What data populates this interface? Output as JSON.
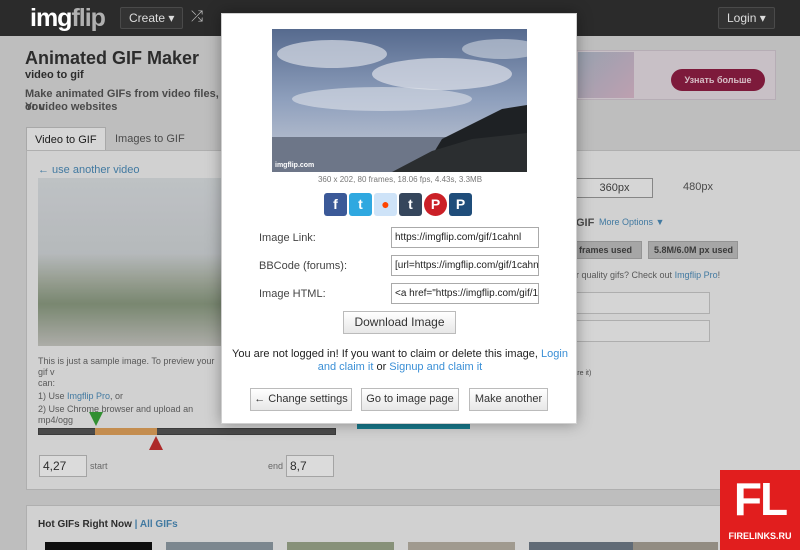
{
  "nav": {
    "logo_img": "img",
    "logo_flip": "flip",
    "create_label": "Create ▾",
    "shuffle_icon": "⤮",
    "login_label": "Login ▾"
  },
  "page": {
    "title": "Animated GIF Maker",
    "subtitle": "video to gif",
    "description_line1": "Make animated GIFs from video files, You",
    "description_line2": "or video websites",
    "tabs": [
      {
        "label": "Video to GIF"
      },
      {
        "label": "Images to GIF"
      }
    ],
    "use_another": "← use another video",
    "sample_note_intro": "This is just a sample image. To preview your gif v",
    "sample_note_can": "can:",
    "sample_note_opt1_prefix": "1) Use ",
    "sample_note_opt1_link": "Imgflip Pro",
    "sample_note_opt1_suffix": ", or",
    "sample_note_opt2": "2) Use Chrome browser and upload an mp4/ogg",
    "start_value": "4,27",
    "start_label": "start",
    "end_label": "end",
    "end_value": "8,7",
    "size_360": "360px",
    "size_480": "480px",
    "gif_label": "GIF",
    "more_options": "More Options ▼",
    "frames_used": "frames used",
    "px_used": "5.8M/6.0M px used",
    "higher_quality_prefix": "her quality gifs? Check out ",
    "higher_quality_link": "Imgflip Pro",
    "higher_quality_suffix": "!",
    "right_input1": "tl",
    "share_it": "share it)",
    "ad_button": "Узнать больше",
    "hot_gifs_title": "Hot GIFs Right Now",
    "hot_gifs_all": "| All GIFs"
  },
  "modal": {
    "watermark": "imgflip.com",
    "gif_meta": "360 x 202, 80 frames, 18.06 fps, 4.43s, 3.3MB",
    "share_icons": [
      "facebook-icon",
      "twitter-icon",
      "reddit-icon",
      "tumblr-icon",
      "pinterest-icon",
      "p-icon"
    ],
    "image_link_label": "Image Link:",
    "image_link_value": "https://imgflip.com/gif/1cahnl",
    "bbcode_label": "BBCode (forums):",
    "bbcode_value": "[url=https://imgflip.com/gif/1cahnl]",
    "html_label": "Image HTML:",
    "html_value": "<a href=\"https://imgflip.com/gif/1c",
    "download_label": "Download Image",
    "login_msg_prefix": "You are not logged in! If you want to claim or delete this image, ",
    "login_link": "Login and claim it",
    "login_or": " or ",
    "signup_link": "Signup and claim it",
    "change_settings_label": "← Change settings",
    "goto_image_label": "Go to image page",
    "make_another_label": "Make another"
  },
  "watermark_fl": {
    "big": "FL",
    "small": "FIRELINKS.RU"
  },
  "colors": {
    "link": "#3a8fd6",
    "fl_red": "#e11e1e",
    "nav_bg": "#2b2b2b"
  }
}
